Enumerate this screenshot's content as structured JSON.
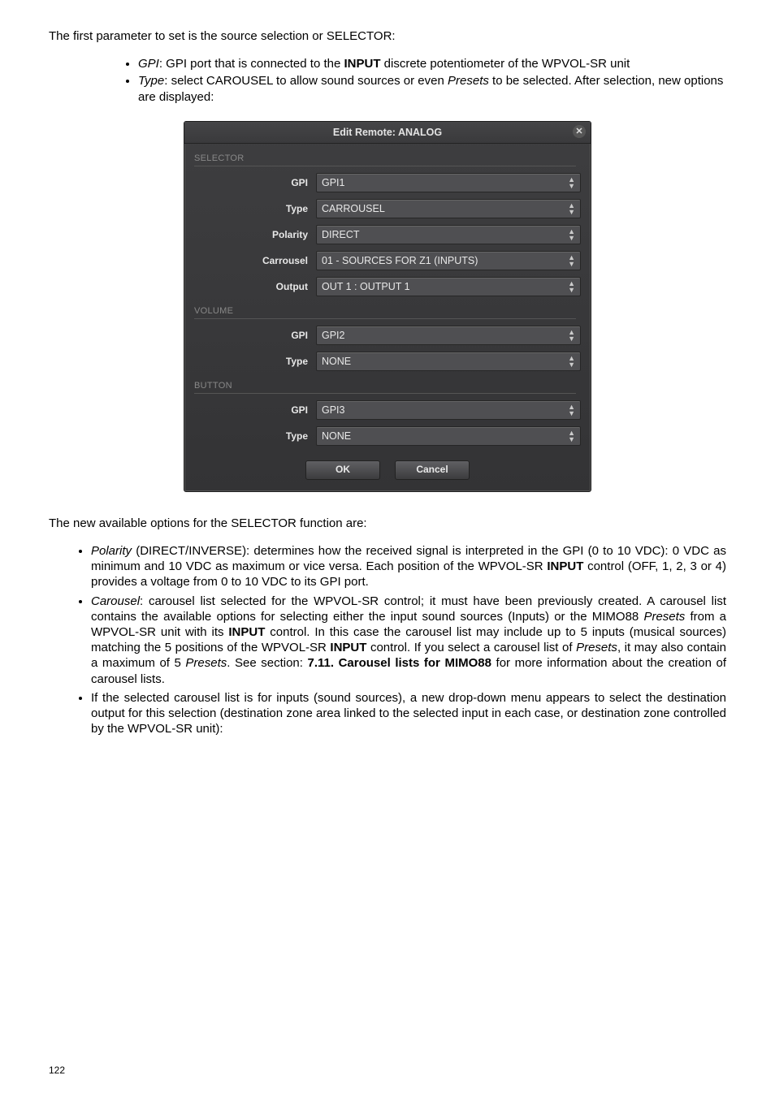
{
  "intro_line": "The first parameter to set is the source selection or SELECTOR:",
  "top_bullets": {
    "b1_pre": "GPI",
    "b1_post": ": GPI port that is connected to the ",
    "b1_bold": "INPUT",
    "b1_tail": " discrete potentiometer of the WPVOL-SR unit",
    "b2_pre": "Type",
    "b2_post": ": select CAROUSEL to allow sound sources or even ",
    "b2_it": "Presets",
    "b2_tail": " to be selected. After selection, new options are displayed:"
  },
  "dialog": {
    "title": "Edit Remote: ANALOG",
    "sections": {
      "selector_head": "SELECTOR",
      "volume_head": "VOLUME",
      "button_head": "BUTTON"
    },
    "labels": {
      "gpi": "GPI",
      "type": "Type",
      "polarity": "Polarity",
      "carrousel": "Carrousel",
      "output": "Output"
    },
    "values": {
      "sel_gpi": "GPI1",
      "sel_type": "CARROUSEL",
      "sel_polarity": "DIRECT",
      "sel_carrousel": "01 - SOURCES FOR Z1 (INPUTS)",
      "sel_output": "OUT 1 : OUTPUT 1",
      "vol_gpi": "GPI2",
      "vol_type": "NONE",
      "btn_gpi": "GPI3",
      "btn_type": "NONE"
    },
    "ok": "OK",
    "cancel": "Cancel"
  },
  "mid_line": "The new available options for the SELECTOR function are:",
  "lower_bullets": {
    "polarity": "Polarity",
    "polarity_text": " (DIRECT/INVERSE): determines how the received signal is interpreted in the GPI (0 to 10 VDC): 0 VDC as minimum and 10 VDC as maximum or vice versa. Each position of the WPVOL-SR ",
    "input1": "INPUT",
    "polarity_tail": " control (OFF, 1, 2, 3 or 4) provides a voltage from 0 to 10 VDC to its GPI port.",
    "carousel": "Carousel",
    "carousel_t1": ": carousel list selected for the WPVOL-SR control; it must have been previously created. A carousel list contains the available options for selecting either the input sound sources (Inputs) or the MIMO88 ",
    "presets1": "Presets",
    "carousel_t2": " from a WPVOL-SR unit with its ",
    "input2": "INPUT",
    "carousel_t3": " control. In this case the carousel list may include up to 5 inputs (musical sources) matching the 5 positions of the WPVOL-SR ",
    "input3": "INPUT",
    "carousel_t4": " control. If you select a carousel list of ",
    "presets2": "Presets",
    "carousel_t5": ", it may also contain a maximum of 5 ",
    "presets3": "Presets",
    "carousel_t6": ". See section: ",
    "secref": "7.11. Carousel lists for MIMO88",
    "carousel_t7": " for more information about the creation of carousel lists.",
    "third": "If the selected carousel list is for inputs (sound sources), a new drop-down menu appears to select the destination output for this selection (destination zone area linked to the selected input in each case, or destination zone controlled by the WPVOL-SR unit):"
  },
  "page_number": "122"
}
